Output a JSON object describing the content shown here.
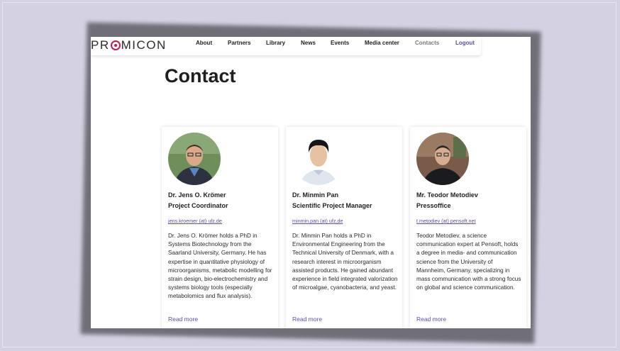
{
  "header": {
    "logo_left": "PR",
    "logo_right": "MICON",
    "nav": [
      {
        "label": "About"
      },
      {
        "label": "Partners"
      },
      {
        "label": "Library"
      },
      {
        "label": "News"
      },
      {
        "label": "Events"
      },
      {
        "label": "Media center"
      },
      {
        "label": "Contacts"
      },
      {
        "label": "Logout"
      }
    ]
  },
  "page": {
    "title": "Contact"
  },
  "contacts": [
    {
      "name": "Dr. Jens O. Krömer",
      "role": "Project Coordinator",
      "email": "jens.kroemer (at) ufz.de",
      "bio": "Dr. Jens O. Krömer holds a PhD in Systems Biotechnology from the Saarland University, Germany. He has expertise in quantitative physiology of microorganisms, metabolic modelling for strain design, bio-electrochemistry and systems biology tools (especially metabolomics and flux analysis).",
      "more": "Read more"
    },
    {
      "name": "Dr. Minmin Pan",
      "role": "Scientific Project Manager",
      "email": "minmin.pan (at) ufz.de",
      "bio": "Dr. Minmin Pan holds a PhD in Environmental Engineering from the Technical University of Denmark, with a research interest in microorganism assisted products. He gained abundant experience in field integrated valorization of microalgae, cyanobacteria, and yeast.",
      "more": "Read more"
    },
    {
      "name": "Mr. Teodor Metodiev",
      "role": "Pressoffice",
      "email": "t.metodiev (at) pensoft.net",
      "bio": "Teodor Metodiev, a science communication expert at Pensoft, holds a degree in media- and communication science from the University of Mannheim, Germany, specializing in mass communication with a strong focus on global and science communication.",
      "more": "Read more"
    }
  ],
  "colors": {
    "accent": "#5b4fa8",
    "logo": "#c21f4e",
    "background": "#d4d1e3"
  }
}
